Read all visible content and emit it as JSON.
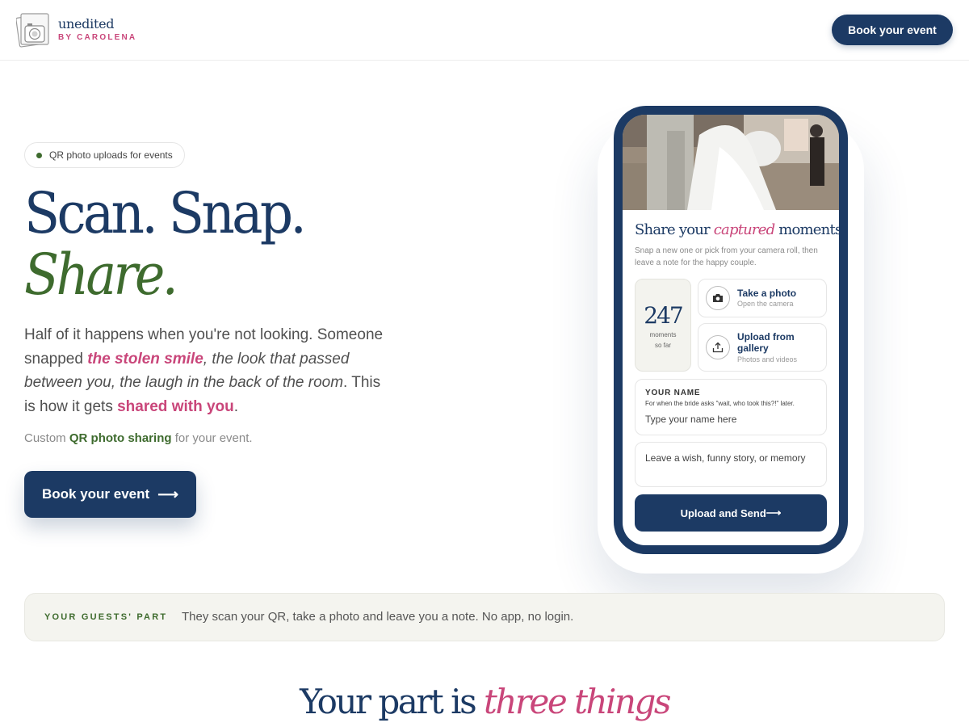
{
  "header": {
    "brand_name": "unedited",
    "brand_sub": "BY CAROLENA",
    "cta_label": "Book your event"
  },
  "hero": {
    "pill_label": "QR photo uploads for events",
    "headline_line1": "Scan. Snap.",
    "headline_line2": "Share.",
    "lede": {
      "part1": "Half of it happens when you're not looking. Someone snapped ",
      "highlight1": "the stolen smile",
      "part2": ", the look that passed between you",
      "part3": ", the laugh in the back of the room",
      "part4": ". This is how it gets ",
      "highlight2": "shared with you",
      "part5": "."
    },
    "custom_prefix": "Custom ",
    "custom_highlight": "QR photo sharing",
    "custom_suffix": " for your event.",
    "cta_label": "Book your event",
    "cta_arrow": "⟶"
  },
  "phone": {
    "title_prefix": "Share your ",
    "title_highlight": "captured",
    "title_suffix": " moments",
    "subtitle": "Snap a new one or pick from your camera roll, then leave a note for the happy couple.",
    "count": "247",
    "count_label_line1": "moments",
    "count_label_line2": "so far",
    "take_photo_title": "Take a photo",
    "take_photo_sub": "Open the camera",
    "upload_title": "Upload from gallery",
    "upload_sub": "Photos and videos",
    "name_label": "YOUR NAME",
    "name_hint": "For when the bride asks \"wait, who took this?!\" later.",
    "name_placeholder": "Type your name here",
    "note_placeholder": "Leave a wish, funny story, or memory",
    "send_label": "Upload and Send",
    "send_arrow": "⟶"
  },
  "guests_band": {
    "label": "YOUR GUESTS' PART",
    "text": "They scan your QR, take a photo and leave you a note. No app, no login."
  },
  "section": {
    "title_prefix": "Your part is ",
    "title_highlight": "three things"
  },
  "colors": {
    "navy": "#1c3a64",
    "pink": "#c9467a",
    "green": "#3e6b2e",
    "band_bg": "#f4f4ef"
  },
  "icons": [
    "camera-logo-icon",
    "camera-icon",
    "upload-icon",
    "arrow-right-icon",
    "status-dot-icon"
  ]
}
